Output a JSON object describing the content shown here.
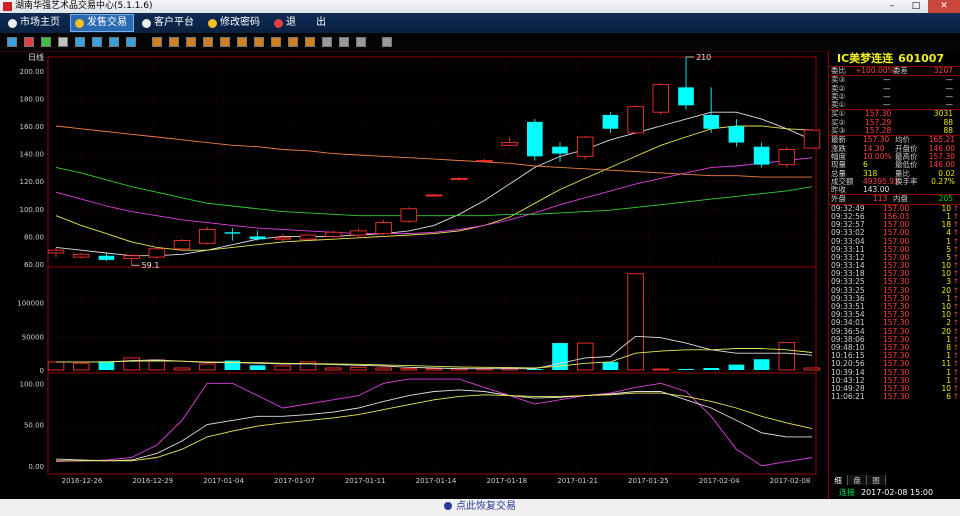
{
  "window": {
    "title": "湖南华强艺术品交易中心(5.1.1.6)",
    "minimize": "–",
    "maximize": "□",
    "close": "✕"
  },
  "menu": [
    {
      "label": "市场主页",
      "icon": "home-icon"
    },
    {
      "label": "发售交易",
      "icon": "trade-icon"
    },
    {
      "label": "客户平台",
      "icon": "client-icon"
    },
    {
      "label": "修改密码",
      "icon": "key-icon"
    },
    {
      "label": "退",
      "icon": "exit-icon"
    },
    {
      "label": "出",
      "icon": ""
    }
  ],
  "toolbar_icons": [
    "bar-chart-icon",
    "trend-icon",
    "candle-icon",
    "list-icon",
    "grid-icon",
    "table-icon",
    "chart-icon",
    "x-icon",
    "fav1-icon",
    "fav2-icon",
    "fav3-icon",
    "fav4-icon",
    "fav5-icon",
    "fav6-icon",
    "fav7-icon",
    "fav8-icon",
    "fav9-icon",
    "fav10-icon",
    "zoom-in-icon",
    "zoom-out-icon",
    "pen-icon",
    "gear-icon"
  ],
  "chart_data": {
    "type": "candlestick",
    "period_label": "日线",
    "x_tick_labels": [
      "2016-12-26",
      "2016-12-29",
      "2017-01-04",
      "2017-01-07",
      "2017-01-11",
      "2017-01-14",
      "2017-01-18",
      "2017-01-21",
      "2017-01-25",
      "2017-02-04",
      "2017-02-08"
    ],
    "price_axis": {
      "ticks": [
        "60.00",
        "80.00",
        "100.00",
        "120.00",
        "140.00",
        "160.00",
        "180.00",
        "200.00"
      ],
      "ylim": [
        60,
        210
      ]
    },
    "volume_axis": {
      "ticks": [
        "0",
        "50000",
        "100000"
      ],
      "ylim": [
        0,
        150000
      ]
    },
    "indicator_axis": {
      "ticks": [
        "0.00",
        "50.00",
        "100.00"
      ],
      "ylim": [
        -10,
        110
      ]
    },
    "annotations": {
      "high": "210",
      "low": "59.1",
      "high_value": 210,
      "low_value": 59.1
    },
    "candles": [
      {
        "o": 68,
        "h": 72,
        "l": 65,
        "c": 70
      },
      {
        "o": 65,
        "h": 68,
        "l": 64,
        "c": 67
      },
      {
        "o": 66,
        "h": 68,
        "l": 62,
        "c": 63
      },
      {
        "o": 64,
        "h": 67,
        "l": 59.1,
        "c": 66
      },
      {
        "o": 65,
        "h": 72,
        "l": 64,
        "c": 71
      },
      {
        "o": 71,
        "h": 78,
        "l": 70,
        "c": 77
      },
      {
        "o": 75,
        "h": 87,
        "l": 74,
        "c": 85
      },
      {
        "o": 83,
        "h": 86,
        "l": 77,
        "c": 82
      },
      {
        "o": 80,
        "h": 84,
        "l": 77,
        "c": 78
      },
      {
        "o": 78,
        "h": 82,
        "l": 76,
        "c": 79
      },
      {
        "o": 78,
        "h": 81,
        "l": 77,
        "c": 81
      },
      {
        "o": 80,
        "h": 84,
        "l": 79,
        "c": 83
      },
      {
        "o": 81,
        "h": 86,
        "l": 79,
        "c": 84
      },
      {
        "o": 82,
        "h": 92,
        "l": 81,
        "c": 90
      },
      {
        "o": 91,
        "h": 101,
        "l": 90,
        "c": 100
      },
      {
        "o": 110,
        "h": 111,
        "l": 109,
        "c": 110
      },
      {
        "o": 122,
        "h": 123,
        "l": 121,
        "c": 122
      },
      {
        "o": 135,
        "h": 136,
        "l": 134,
        "c": 135
      },
      {
        "o": 146,
        "h": 152,
        "l": 145,
        "c": 148
      },
      {
        "o": 163,
        "h": 165,
        "l": 135,
        "c": 138
      },
      {
        "o": 145,
        "h": 148,
        "l": 134,
        "c": 140
      },
      {
        "o": 138,
        "h": 153,
        "l": 136,
        "c": 152
      },
      {
        "o": 168,
        "h": 170,
        "l": 155,
        "c": 158
      },
      {
        "o": 155,
        "h": 175,
        "l": 154,
        "c": 174
      },
      {
        "o": 170,
        "h": 191,
        "l": 168,
        "c": 190
      },
      {
        "o": 188,
        "h": 210,
        "l": 172,
        "c": 175
      },
      {
        "o": 168,
        "h": 188,
        "l": 155,
        "c": 158
      },
      {
        "o": 160,
        "h": 165,
        "l": 145,
        "c": 148
      },
      {
        "o": 145,
        "h": 148,
        "l": 130,
        "c": 132
      },
      {
        "o": 132,
        "h": 145,
        "l": 130,
        "c": 143
      },
      {
        "o": 144,
        "h": 158,
        "l": 144,
        "c": 157
      }
    ],
    "volumes": [
      12000,
      10000,
      13000,
      18000,
      15000,
      3000,
      9000,
      14000,
      7000,
      6000,
      12000,
      3000,
      4000,
      3000,
      2000,
      2000,
      2000,
      2000,
      3000,
      1000,
      40000,
      40000,
      12000,
      143000,
      1000,
      600,
      3000,
      8000,
      16000,
      41000,
      3000
    ],
    "ma_series": [
      {
        "color": "#e0e0e0",
        "values": [
          72,
          70,
          68,
          66,
          66,
          67,
          70,
          74,
          78,
          80,
          80,
          80,
          81,
          82,
          84,
          88,
          96,
          106,
          118,
          130,
          138,
          143,
          150,
          155,
          160,
          165,
          170,
          170,
          165,
          158,
          150
        ]
      },
      {
        "color": "#e8e850",
        "values": [
          95,
          88,
          82,
          76,
          72,
          70,
          70,
          72,
          74,
          76,
          77,
          78,
          79,
          80,
          81,
          82,
          84,
          88,
          94,
          104,
          114,
          122,
          130,
          138,
          146,
          152,
          158,
          160,
          160,
          158,
          157
        ]
      },
      {
        "color": "#e040e0",
        "values": [
          112,
          107,
          102,
          98,
          95,
          92,
          90,
          88,
          86,
          85,
          84,
          83,
          82,
          82,
          82,
          83,
          85,
          88,
          92,
          97,
          103,
          108,
          113,
          118,
          122,
          126,
          130,
          131,
          133,
          135,
          137
        ]
      },
      {
        "color": "#30d030",
        "values": [
          130,
          126,
          121,
          116,
          112,
          108,
          104,
          102,
          100,
          98,
          97,
          96,
          95,
          95,
          95,
          95,
          95,
          95,
          96,
          96,
          97,
          98,
          99,
          101,
          103,
          105,
          107,
          109,
          111,
          113,
          116
        ]
      },
      {
        "color": "#f08040",
        "values": [
          160,
          158,
          156,
          154,
          152,
          150,
          148,
          146,
          145,
          143,
          142,
          140,
          139,
          138,
          137,
          136,
          135,
          134,
          133,
          131,
          130,
          129,
          128,
          127,
          126,
          125,
          124,
          124,
          123,
          123,
          123
        ]
      }
    ],
    "vol_ma_series": [
      {
        "color": "#e0e0e0",
        "values": [
          12000,
          12000,
          12000,
          14000,
          15000,
          13000,
          11000,
          11000,
          10000,
          9000,
          9000,
          8000,
          7000,
          6000,
          4000,
          3000,
          2000,
          2000,
          2000,
          2000,
          10000,
          18000,
          20000,
          50000,
          48000,
          40000,
          30000,
          25000,
          25000,
          25000,
          22000
        ]
      },
      {
        "color": "#e8e850",
        "values": [
          12000,
          12000,
          12000,
          13000,
          13500,
          13000,
          12000,
          11500,
          11000,
          10000,
          9500,
          9000,
          8500,
          7500,
          6500,
          5500,
          4500,
          4000,
          3500,
          3000,
          6000,
          10000,
          12000,
          25000,
          28000,
          30000,
          30000,
          32000,
          32000,
          30000,
          26000
        ]
      }
    ],
    "indicator_series": [
      {
        "color": "#e040e0",
        "values": [
          5,
          6,
          7,
          10,
          25,
          55,
          100,
          100,
          85,
          70,
          75,
          80,
          85,
          100,
          105,
          105,
          105,
          95,
          85,
          75,
          80,
          85,
          88,
          95,
          100,
          90,
          60,
          20,
          0,
          5,
          10
        ]
      },
      {
        "color": "#e0e0e0",
        "values": [
          8,
          7,
          6,
          7,
          15,
          30,
          50,
          55,
          60,
          60,
          62,
          65,
          70,
          78,
          85,
          90,
          92,
          90,
          85,
          82,
          83,
          85,
          87,
          90,
          90,
          80,
          70,
          55,
          40,
          35,
          35
        ]
      },
      {
        "color": "#e8e850",
        "values": [
          6,
          6,
          6,
          6,
          10,
          20,
          35,
          42,
          48,
          52,
          55,
          58,
          62,
          68,
          74,
          80,
          84,
          86,
          85,
          84,
          84,
          85,
          86,
          88,
          88,
          84,
          78,
          70,
          60,
          52,
          45
        ]
      }
    ]
  },
  "quote": {
    "name": "IC美梦连连",
    "code": "601007",
    "weibi_label": "委比",
    "weibi_value": "+100.00%",
    "weicha_label": "委差",
    "weicha_value": "3207",
    "sells": [
      {
        "label": "卖③",
        "price": "—",
        "vol": "—"
      },
      {
        "label": "卖②",
        "price": "—",
        "vol": "—"
      },
      {
        "label": "卖②",
        "price": "—",
        "vol": "—"
      },
      {
        "label": "卖①",
        "price": "—",
        "vol": "—"
      }
    ],
    "buys": [
      {
        "label": "买①",
        "price": "157.30",
        "vol": "3031"
      },
      {
        "label": "买②",
        "price": "157.29",
        "vol": "88"
      },
      {
        "label": "买③",
        "price": "157.28",
        "vol": "88"
      }
    ],
    "stats": [
      {
        "l1": "最新",
        "v1": "157.30",
        "l2": "均价",
        "v2": "165.21"
      },
      {
        "l1": "涨跌",
        "v1": "14.30",
        "l2": "开盘价",
        "v2": "146.00"
      },
      {
        "l1": "幅度",
        "v1": "10.00%",
        "l2": "最高价",
        "v2": "157.30"
      },
      {
        "l1": "现量",
        "v1": "6",
        "l2": "最低价",
        "v2": "146.00"
      },
      {
        "l1": "总量",
        "v1": "318",
        "l2": "量比",
        "v2": "0.02"
      },
      {
        "l1": "成交额",
        "v1": "49395.93",
        "l2": "换手率",
        "v2": "0.27%"
      },
      {
        "l1": "昨收",
        "v1": "143.00",
        "l2": "",
        "v2": ""
      }
    ],
    "waipan_label": "外盘",
    "waipan_value": "113",
    "neipan_label": "内盘",
    "neipan_value": "205",
    "ticks": [
      {
        "t": "09:32:49",
        "p": "157.00",
        "v": "10"
      },
      {
        "t": "09:32:56",
        "p": "156.03",
        "v": "1"
      },
      {
        "t": "09:32:57",
        "p": "157.00",
        "v": "18"
      },
      {
        "t": "09:33:02",
        "p": "157.00",
        "v": "4"
      },
      {
        "t": "09:33:04",
        "p": "157.00",
        "v": "1"
      },
      {
        "t": "09:33:11",
        "p": "157.00",
        "v": "5"
      },
      {
        "t": "09:33:12",
        "p": "157.00",
        "v": "5"
      },
      {
        "t": "09:33:14",
        "p": "157.30",
        "v": "10"
      },
      {
        "t": "09:33:18",
        "p": "157.30",
        "v": "10"
      },
      {
        "t": "09:33:25",
        "p": "157.30",
        "v": "3"
      },
      {
        "t": "09:33:25",
        "p": "157.30",
        "v": "20"
      },
      {
        "t": "09:33:36",
        "p": "157.30",
        "v": "1"
      },
      {
        "t": "09:33:51",
        "p": "157.30",
        "v": "10"
      },
      {
        "t": "09:33:54",
        "p": "157.30",
        "v": "10"
      },
      {
        "t": "09:34:01",
        "p": "157.30",
        "v": "2"
      },
      {
        "t": "09:36:54",
        "p": "157.30",
        "v": "20"
      },
      {
        "t": "09:38:06",
        "p": "157.30",
        "v": "1"
      },
      {
        "t": "09:48:10",
        "p": "157.30",
        "v": "8"
      },
      {
        "t": "10:16:15",
        "p": "157.30",
        "v": "1"
      },
      {
        "t": "10:20:56",
        "p": "157.30",
        "v": "11"
      },
      {
        "t": "10:39:14",
        "p": "157.30",
        "v": "1"
      },
      {
        "t": "10:43:12",
        "p": "157.30",
        "v": "1"
      },
      {
        "t": "10:49:28",
        "p": "157.30",
        "v": "10"
      },
      {
        "t": "11:06:21",
        "p": "157.30",
        "v": "6"
      }
    ],
    "tick_arrow": "↑",
    "tabs": [
      "细",
      "盘",
      "图"
    ],
    "status": "连接",
    "datetime": "2017-02-08 15:00"
  },
  "footer": {
    "label": "点此恢复交易"
  }
}
